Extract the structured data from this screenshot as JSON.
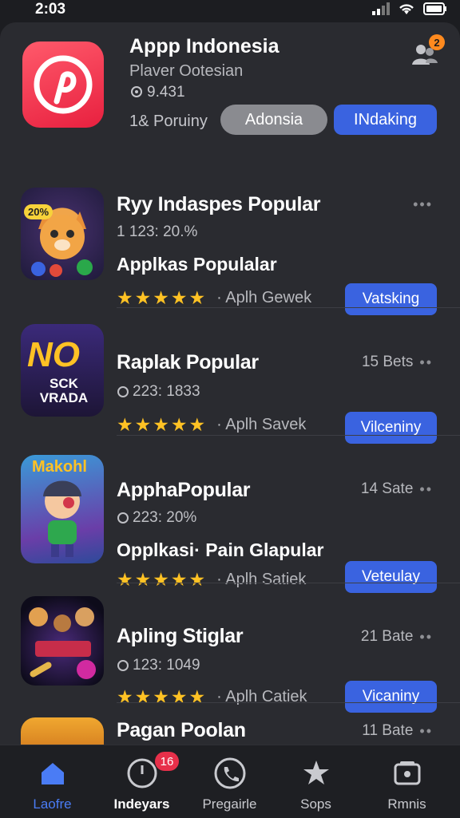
{
  "status_bar": {
    "time": "2:03"
  },
  "hero": {
    "title": "Appp Indonesia",
    "subtitle": "Plaver Ootesian",
    "rating": "9.431",
    "count": "1& Poruiny",
    "gray_button": "Adonsia",
    "blue_button": "INdaking",
    "badge": "2"
  },
  "apps": [
    {
      "title": "Ryy Indaspes Popular",
      "meta": "1 123: 20.%",
      "subtitle": "Applkas Populalar",
      "developer": "Aplh Gewek",
      "button": "Vatsking",
      "right": "",
      "icon_text": "20%"
    },
    {
      "title": "Raplak Popular",
      "meta": "223: 1833",
      "subtitle": "",
      "developer": "Aplh Savek",
      "button": "Vilceniny",
      "right": "15 Bets",
      "icon_text": "NO",
      "icon_text2": "SCK VRADA"
    },
    {
      "title": "ApphaPopular",
      "meta": "223: 20%",
      "subtitle": "Opplkasi· Pain Glapular",
      "developer": "Aplh Satiek",
      "button": "Veteulay",
      "right": "14 Sate",
      "icon_text": "Makohl"
    },
    {
      "title": "Apling Stiglar",
      "meta": "123: 1049",
      "subtitle": "",
      "developer": "Aplh Catiek",
      "button": "Vicaniny",
      "right": "21 Bate"
    },
    {
      "title": "Pagan Poolan",
      "right": "11 Bate"
    }
  ],
  "tabs": [
    {
      "label": "Laofre",
      "icon": "home-icon"
    },
    {
      "label": "Indeyars",
      "icon": "clock-icon",
      "badge": "16"
    },
    {
      "label": "Pregairle",
      "icon": "phone-icon"
    },
    {
      "label": "Sops",
      "icon": "star-icon"
    },
    {
      "label": "Rmnis",
      "icon": "wallet-icon"
    }
  ],
  "colors": {
    "accent": "#3a63e0",
    "star": "#ffc224",
    "tab_active": "#4a7cf5",
    "badge": "#e7304a"
  }
}
